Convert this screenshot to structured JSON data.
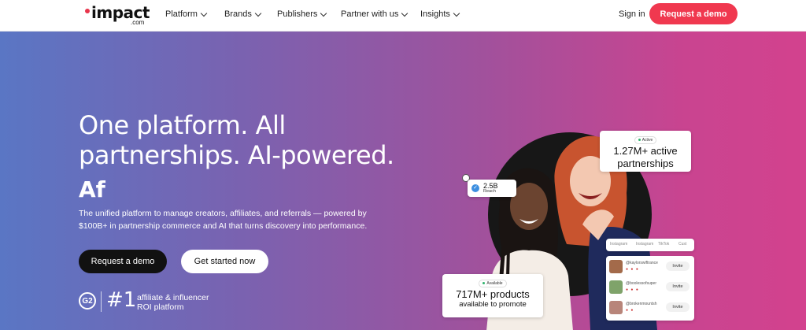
{
  "nav": {
    "logo": "impact",
    "logo_suffix": ".com",
    "items": [
      {
        "label": "Platform"
      },
      {
        "label": "Brands"
      },
      {
        "label": "Publishers"
      },
      {
        "label": "Partner with us"
      },
      {
        "label": "Insights"
      }
    ],
    "sign_in": "Sign in",
    "demo": "Request a demo"
  },
  "hero": {
    "headline": "One platform. All partnerships. AI-powered.",
    "typing": "Af",
    "description": "The unified platform to manage creators, affiliates, and referrals — powered by $100B+ in partnership commerce and AI that turns discovery into performance.",
    "primary_button": "Request a demo",
    "secondary_button": "Get started now",
    "g2_logo": "G2",
    "rank": "#1",
    "rank_text_1": "affiliate & influencer",
    "rank_text_2": "ROI platform"
  },
  "cards": {
    "partnerships": {
      "badge": "Active",
      "value": "1.27M+ active",
      "label": "partnerships"
    },
    "reach": {
      "value": "2.5B",
      "label": "Reach"
    },
    "products": {
      "badge": "Available",
      "value": "717M+ products",
      "label": "available to promote"
    },
    "tabs": [
      "Instagram",
      "Instagram",
      "TikTok",
      "Cust"
    ],
    "creators": [
      {
        "handle": "@kaylorswiftrance",
        "invite": "Invite"
      },
      {
        "handle": "@boolessofsuper",
        "invite": "Invite"
      },
      {
        "handle": "@brokenmountsh",
        "invite": "Invite"
      }
    ]
  },
  "colors": {
    "accent": "#f0384f",
    "dark_button": "#111111"
  }
}
